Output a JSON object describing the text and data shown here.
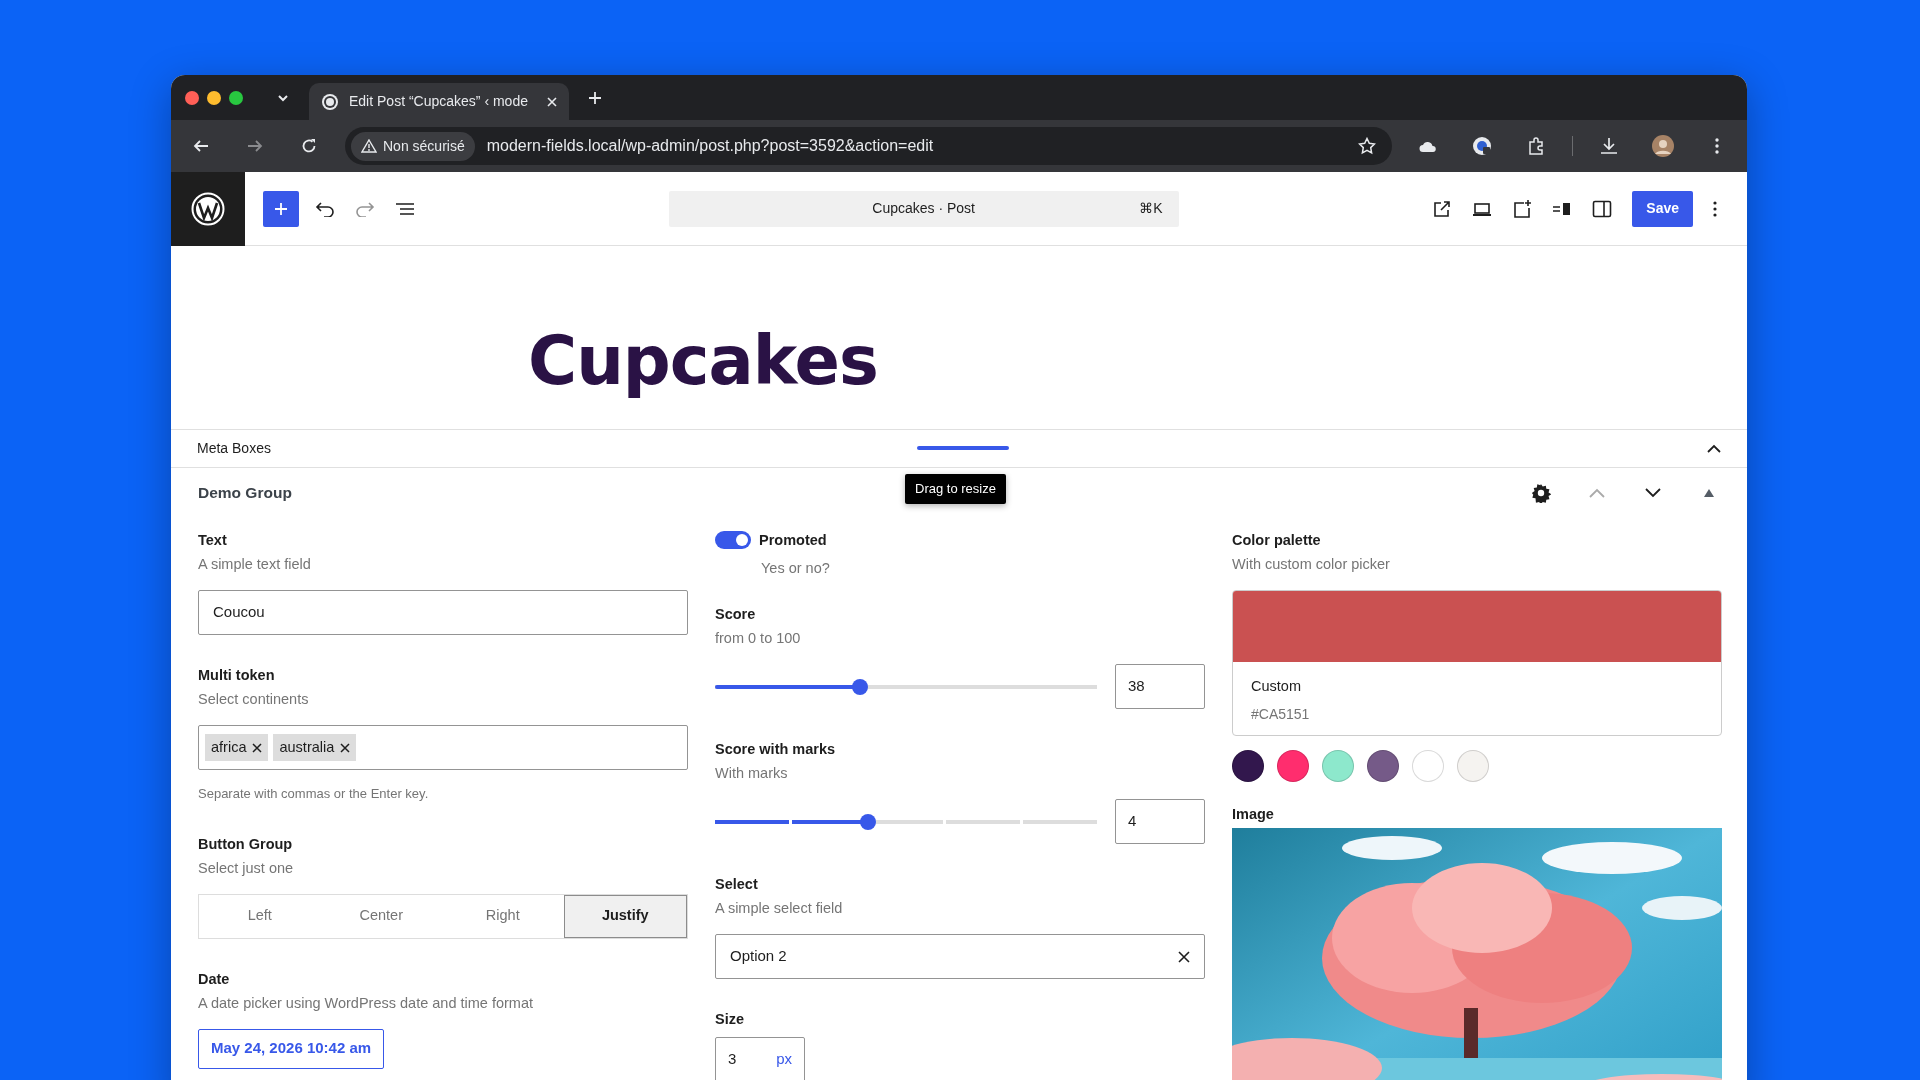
{
  "browser": {
    "tab_title": "Edit Post “Cupcakes” ‹ mode",
    "security": "Non sécurisé",
    "url": "modern-fields.local/wp-admin/post.php?post=3592&action=edit"
  },
  "toolbar": {
    "command": "Cupcakes · Post",
    "shortcut": "⌘K",
    "save": "Save"
  },
  "post_title": "Cupcakes",
  "meta_boxes": {
    "title": "Meta Boxes",
    "expanded": true,
    "tooltip": "Drag to resize"
  },
  "group": {
    "title": "Demo Group",
    "columns": [
      [
        {
          "kind": "text",
          "label": "Text",
          "description": "A simple text field",
          "value": "Coucou"
        },
        {
          "kind": "tokens",
          "label": "Multi token",
          "description": "Select continents",
          "tokens": [
            "africa",
            "australia"
          ],
          "help": "Separate with commas or the Enter key."
        },
        {
          "kind": "buttons",
          "label": "Button Group",
          "description": "Select just one",
          "options": [
            {
              "label": "Left",
              "selected": false
            },
            {
              "label": "Center",
              "selected": false
            },
            {
              "label": "Right",
              "selected": false
            },
            {
              "label": "Justify",
              "selected": true
            }
          ]
        },
        {
          "kind": "date",
          "label": "Date",
          "description": "A date picker using WordPress date and time format",
          "value": "May 24, 2026 10:42 am"
        }
      ],
      [
        {
          "kind": "toggle",
          "label": "Promoted",
          "description": "Yes or no?",
          "on": true
        },
        {
          "kind": "range",
          "label": "Score",
          "description": "from 0 to 100",
          "level": 0.38,
          "value": "38"
        },
        {
          "kind": "marks",
          "label": "Score with marks",
          "description": "With marks",
          "level": 0.4,
          "value": "4"
        },
        {
          "kind": "select",
          "label": "Select",
          "description": "A simple select field",
          "value": "Option 2"
        },
        {
          "kind": "unit",
          "label": "Size",
          "value": "3",
          "unit": "px"
        }
      ],
      [
        {
          "kind": "color",
          "label": "Color palette",
          "description": "With custom color picker",
          "color": "#ca5151",
          "name": "Custom",
          "hex": "#CA5151",
          "swatches": [
            {
              "color": "#32174d"
            },
            {
              "color": "#ff2d6e"
            },
            {
              "color": "#8de8cc"
            },
            {
              "color": "#755a88"
            },
            {
              "color": "#ffffff"
            },
            {
              "color": "#f5f3f0"
            }
          ]
        },
        {
          "label": "Image"
        }
      ]
    ]
  }
}
